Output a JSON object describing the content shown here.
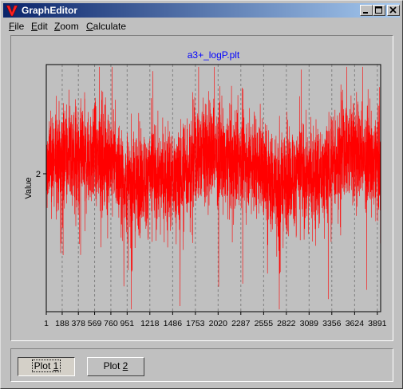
{
  "window": {
    "title": "GraphEditor",
    "icon": "v-logo-icon",
    "controls": [
      "minimize-icon",
      "maximize-icon",
      "close-icon"
    ]
  },
  "menu": [
    {
      "label": "File",
      "accel": "F"
    },
    {
      "label": "Edit",
      "accel": "E"
    },
    {
      "label": "Zoom",
      "accel": "Z"
    },
    {
      "label": "Calculate",
      "accel": "C"
    }
  ],
  "chart_data": {
    "type": "line",
    "title": "a3+_logP.plt",
    "ylabel": "Value",
    "xlabel": "",
    "x_ticks": [
      1,
      188,
      378,
      569,
      760,
      951,
      1218,
      1486,
      1753,
      2020,
      2287,
      2555,
      2822,
      3089,
      3356,
      3624,
      3891
    ],
    "y_ticks": [
      2
    ],
    "series": [
      {
        "color": "#ff0000",
        "n_points": 3930,
        "noise": "dense random fluctuation around ~2.0"
      }
    ],
    "grid": "vertical dashed",
    "colors": {
      "title": "#0000ff",
      "line": "#ff0000",
      "grid": "#808080"
    }
  },
  "buttons": {
    "plot1": {
      "pre": "Plot ",
      "accel": "1"
    },
    "plot2": {
      "pre": "Plot ",
      "accel": "2"
    }
  }
}
